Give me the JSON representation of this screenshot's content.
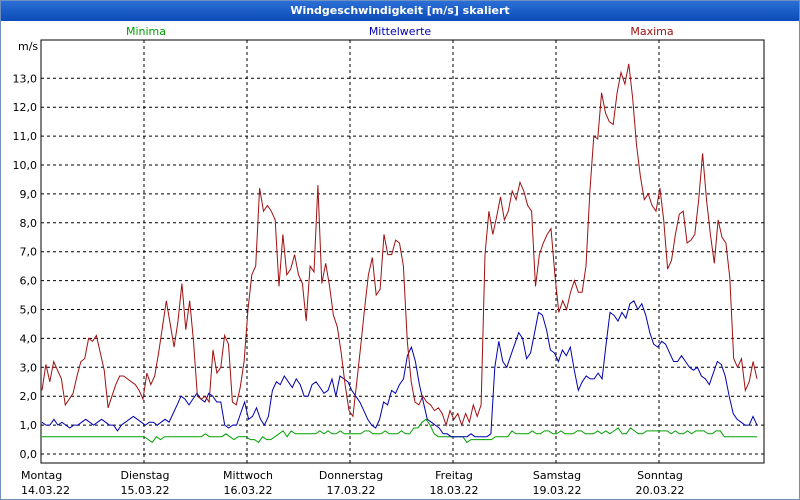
{
  "window": {
    "title": "Windgeschwindigkeit [m/s] skaliert"
  },
  "chart_data": {
    "type": "line",
    "title": "Windgeschwindigkeit [m/s] skaliert",
    "ylabel": "m/s",
    "ylim": [
      -0.2,
      14.0
    ],
    "yticks": [
      "0,0",
      "1,0",
      "2,0",
      "3,0",
      "4,0",
      "5,0",
      "6,0",
      "7,0",
      "8,0",
      "9,0",
      "10,0",
      "11,0",
      "12,0",
      "13,0"
    ],
    "x_labels": [
      {
        "day": "Montag",
        "date": "14.03.22"
      },
      {
        "day": "Dienstag",
        "date": "15.03.22"
      },
      {
        "day": "Mittwoch",
        "date": "16.03.22"
      },
      {
        "day": "Donnerstag",
        "date": "17.03.22"
      },
      {
        "day": "Freitag",
        "date": "18.03.22"
      },
      {
        "day": "Samstag",
        "date": "19.03.22"
      },
      {
        "day": "Sonntag",
        "date": "20.03.22"
      }
    ],
    "grid": true,
    "series": [
      {
        "name": "Minima",
        "color": "#00a000",
        "values": [
          0.6,
          0.6,
          0.6,
          0.6,
          0.6,
          0.6,
          0.6,
          0.6,
          0.6,
          0.6,
          0.6,
          0.6,
          0.6,
          0.6,
          0.6,
          0.6,
          0.6,
          0.6,
          0.6,
          0.6,
          0.6,
          0.6,
          0.6,
          0.6,
          0.6,
          0.6,
          0.5,
          0.4,
          0.6,
          0.5,
          0.6,
          0.6,
          0.6,
          0.6,
          0.6,
          0.6,
          0.6,
          0.6,
          0.6,
          0.6,
          0.7,
          0.6,
          0.6,
          0.6,
          0.6,
          0.7,
          0.6,
          0.5,
          0.6,
          0.6,
          0.6,
          0.5,
          0.5,
          0.4,
          0.6,
          0.5,
          0.5,
          0.6,
          0.7,
          0.8,
          0.6,
          0.8,
          0.7,
          0.7,
          0.7,
          0.7,
          0.7,
          0.7,
          0.8,
          0.7,
          0.8,
          0.7,
          0.7,
          0.8,
          0.7,
          0.7,
          0.7,
          0.7,
          0.7,
          0.8,
          0.8,
          0.7,
          0.7,
          0.7,
          0.8,
          0.7,
          0.7,
          0.7,
          0.8,
          0.7,
          0.7,
          0.9,
          0.9,
          1.1,
          1.2,
          1.0,
          0.7,
          0.6,
          0.6,
          0.6,
          0.6,
          0.6,
          0.6,
          0.6,
          0.4,
          0.5,
          0.5,
          0.5,
          0.5,
          0.5,
          0.5,
          0.6,
          0.6,
          0.6,
          0.6,
          0.8,
          0.7,
          0.7,
          0.7,
          0.7,
          0.8,
          0.7,
          0.7,
          0.8,
          0.8,
          0.7,
          0.7,
          0.8,
          0.7,
          0.7,
          0.7,
          0.8,
          0.8,
          0.7,
          0.7,
          0.7,
          0.8,
          0.7,
          0.8,
          0.7,
          0.8,
          0.9,
          0.7,
          0.7,
          0.9,
          0.8,
          0.7,
          0.7,
          0.8,
          0.8,
          0.8,
          0.8,
          0.8,
          0.8,
          0.7,
          0.8,
          0.7,
          0.7,
          0.8,
          0.7,
          0.8,
          0.8,
          0.8,
          0.7,
          0.7,
          0.8,
          0.8,
          0.6,
          0.6,
          0.6,
          0.6,
          0.6,
          0.6,
          0.6,
          0.6,
          0.6
        ]
      },
      {
        "name": "Mittelwerte",
        "color": "#0000b0",
        "values": [
          1.1,
          1.0,
          1.0,
          1.2,
          1.0,
          1.1,
          1.0,
          0.9,
          1.0,
          1.0,
          1.1,
          1.2,
          1.1,
          1.0,
          1.1,
          1.2,
          1.1,
          1.0,
          1.0,
          0.8,
          1.0,
          1.1,
          1.2,
          1.3,
          1.2,
          1.1,
          1.0,
          1.1,
          1.1,
          1.0,
          1.1,
          1.2,
          1.1,
          1.4,
          1.7,
          2.0,
          1.9,
          1.7,
          1.9,
          2.1,
          1.9,
          1.8,
          2.1,
          2.0,
          1.8,
          1.8,
          1.0,
          0.9,
          1.0,
          1.0,
          1.4,
          1.8,
          1.2,
          1.3,
          1.6,
          1.2,
          1.0,
          1.3,
          2.2,
          2.5,
          2.4,
          2.7,
          2.5,
          2.3,
          2.6,
          2.4,
          2.0,
          2.0,
          2.4,
          2.5,
          2.3,
          2.1,
          2.2,
          2.6,
          2.0,
          2.7,
          2.6,
          2.5,
          2.2,
          2.0,
          1.8,
          1.5,
          1.2,
          1.0,
          0.9,
          1.2,
          1.8,
          1.7,
          2.2,
          2.1,
          2.4,
          2.6,
          3.4,
          3.7,
          3.2,
          2.4,
          1.8,
          1.2,
          1.1,
          1.0,
          0.9,
          0.7,
          0.7,
          0.6,
          0.6,
          0.6,
          0.6,
          0.6,
          0.7,
          0.6,
          0.6,
          0.6,
          0.6,
          0.7,
          3.0,
          3.9,
          3.2,
          3.0,
          3.4,
          3.8,
          4.2,
          4.0,
          3.3,
          3.5,
          4.2,
          4.9,
          4.8,
          4.3,
          3.6,
          3.5,
          3.2,
          3.6,
          3.4,
          3.7,
          2.9,
          2.2,
          2.5,
          2.7,
          2.6,
          2.6,
          2.8,
          2.6,
          3.8,
          4.9,
          4.8,
          4.6,
          4.9,
          4.7,
          5.2,
          5.3,
          5.0,
          5.2,
          4.8,
          4.2,
          3.8,
          3.7,
          3.9,
          3.8,
          3.5,
          3.2,
          3.2,
          3.4,
          3.2,
          3.0,
          2.9,
          3.0,
          2.7,
          2.6,
          2.4,
          2.8,
          3.2,
          3.1,
          2.7,
          2.0,
          1.4,
          1.2,
          1.1,
          1.0,
          1.0,
          1.3,
          1.0
        ]
      },
      {
        "name": "Maxima",
        "color": "#a01010",
        "values": [
          2.2,
          3.1,
          2.5,
          3.2,
          2.9,
          2.6,
          1.7,
          1.9,
          2.1,
          2.7,
          3.2,
          3.3,
          4.0,
          3.9,
          4.1,
          3.5,
          2.9,
          1.6,
          2.0,
          2.4,
          2.7,
          2.7,
          2.6,
          2.5,
          2.4,
          2.2,
          1.9,
          2.8,
          2.4,
          2.7,
          3.5,
          4.4,
          5.3,
          4.5,
          3.7,
          4.6,
          5.9,
          4.3,
          5.3,
          3.9,
          2.0,
          1.9,
          2.0,
          1.8,
          3.6,
          2.8,
          3.0,
          4.1,
          3.8,
          1.8,
          1.7,
          2.3,
          3.2,
          5.0,
          6.2,
          6.5,
          9.2,
          8.4,
          8.6,
          8.4,
          8.1,
          5.8,
          7.6,
          6.2,
          6.4,
          6.9,
          6.2,
          5.9,
          4.6,
          6.5,
          6.3,
          9.3,
          5.9,
          6.6,
          5.8,
          4.8,
          4.4,
          3.5,
          2.4,
          1.5,
          1.3,
          2.5,
          3.7,
          5.0,
          6.2,
          6.8,
          5.5,
          5.7,
          7.6,
          6.9,
          6.9,
          7.4,
          7.3,
          6.5,
          3.9,
          2.5,
          1.8,
          1.7,
          2.0,
          1.8,
          1.7,
          1.5,
          1.6,
          1.4,
          1.0,
          1.5,
          1.2,
          1.4,
          1.0,
          1.4,
          1.1,
          1.7,
          1.3,
          1.7,
          6.9,
          8.4,
          7.6,
          8.2,
          8.9,
          8.1,
          8.4,
          9.1,
          8.8,
          9.4,
          9.1,
          8.6,
          8.4,
          5.8,
          6.9,
          7.3,
          7.6,
          7.8,
          6.2,
          4.9,
          5.3,
          5.0,
          5.6,
          6.0,
          5.6,
          5.6,
          6.5,
          9.1,
          11.0,
          10.9,
          12.5,
          11.8,
          11.5,
          11.4,
          12.5,
          13.2,
          12.8,
          13.5,
          12.3,
          10.7,
          9.6,
          8.8,
          9.0,
          8.6,
          8.4,
          9.2,
          8.1,
          6.4,
          6.7,
          7.6,
          8.3,
          8.4,
          7.3,
          7.4,
          7.6,
          8.8,
          10.4,
          8.8,
          7.6,
          6.6,
          8.1,
          7.5,
          7.3,
          6.1,
          3.3,
          3.0,
          3.3,
          2.2,
          2.5,
          3.2,
          2.6
        ]
      }
    ]
  }
}
